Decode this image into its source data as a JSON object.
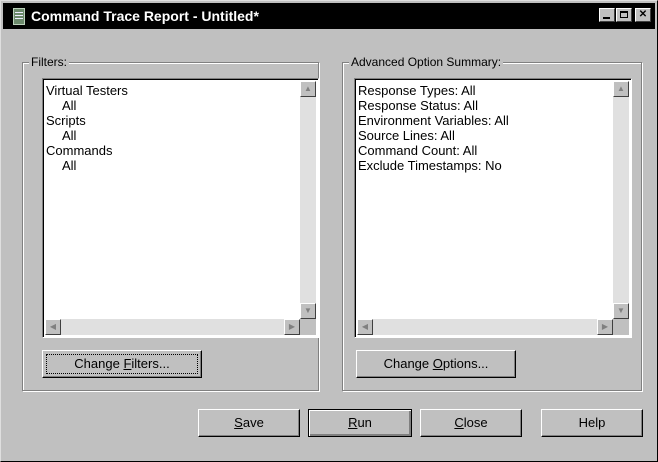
{
  "window": {
    "title": "Command Trace Report - Untitled*"
  },
  "filters": {
    "legend": "Filters:",
    "items": [
      {
        "text": "Virtual Testers",
        "indent": false
      },
      {
        "text": "All",
        "indent": true
      },
      {
        "text": "Scripts",
        "indent": false
      },
      {
        "text": "All",
        "indent": true
      },
      {
        "text": "Commands",
        "indent": false
      },
      {
        "text": "All",
        "indent": true
      }
    ],
    "button": {
      "pre": "Change ",
      "mnemonic": "F",
      "post": "ilters..."
    }
  },
  "advanced": {
    "legend": "Advanced Option Summary:",
    "items": [
      "Response Types: All",
      "Response Status: All",
      "Environment Variables: All",
      "Source Lines: All",
      "Command Count: All",
      "Exclude Timestamps: No"
    ],
    "button": {
      "pre": "Change ",
      "mnemonic": "O",
      "post": "ptions..."
    }
  },
  "buttons": {
    "save": {
      "mnemonic": "S",
      "rest": "ave"
    },
    "run": {
      "mnemonic": "R",
      "rest": "un"
    },
    "close": {
      "mnemonic": "C",
      "rest": "lose"
    },
    "help": {
      "label": "Help"
    }
  },
  "icons": {
    "app": "report-icon",
    "minimize": "minimize-icon",
    "maximize": "maximize-icon",
    "close": "close-icon"
  }
}
